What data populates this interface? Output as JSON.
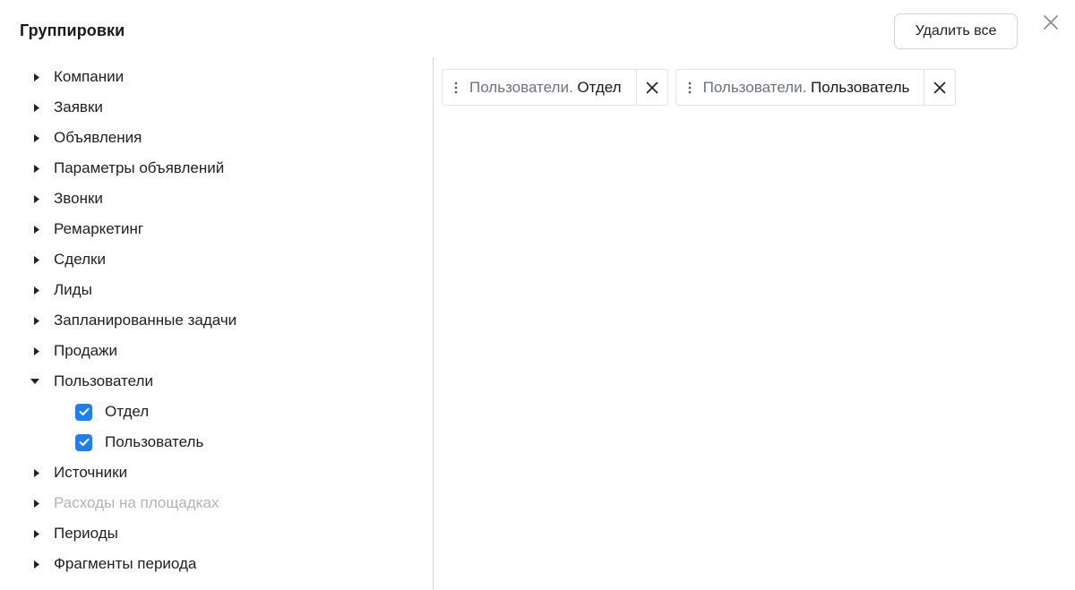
{
  "header": {
    "title": "Группировки",
    "delete_all_label": "Удалить все"
  },
  "tree": {
    "items": [
      {
        "label": "Компании"
      },
      {
        "label": "Заявки"
      },
      {
        "label": "Объявления"
      },
      {
        "label": "Параметры объявлений"
      },
      {
        "label": "Звонки"
      },
      {
        "label": "Ремаркетинг"
      },
      {
        "label": "Сделки"
      },
      {
        "label": "Лиды"
      },
      {
        "label": "Запланированные задачи"
      },
      {
        "label": "Продажи"
      },
      {
        "label": "Пользователи",
        "expanded": true,
        "children": [
          {
            "label": "Отдел",
            "checked": true
          },
          {
            "label": "Пользователь",
            "checked": true
          }
        ]
      },
      {
        "label": "Источники"
      },
      {
        "label": "Расходы на площадках",
        "disabled": true
      },
      {
        "label": "Периоды"
      },
      {
        "label": "Фрагменты периода"
      }
    ]
  },
  "selected": [
    {
      "prefix": "Пользователи.",
      "value": "Отдел"
    },
    {
      "prefix": "Пользователи.",
      "value": "Пользователь"
    }
  ],
  "colors": {
    "accent": "#1e7ff5",
    "disabled_text": "#b3b3b3",
    "chip_prefix": "#6b7280"
  }
}
